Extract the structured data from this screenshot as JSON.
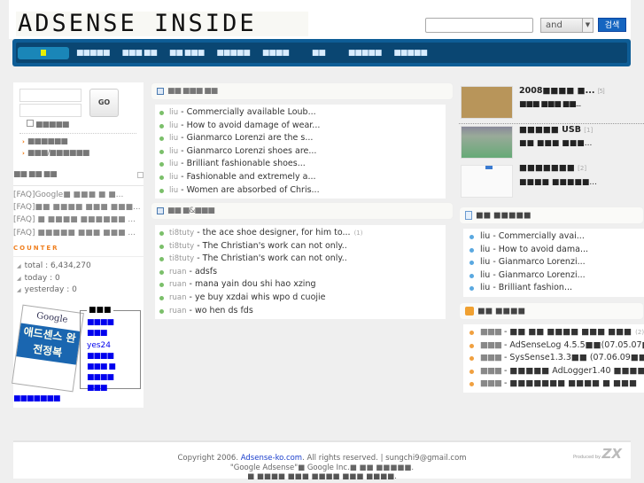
{
  "header": {
    "logo": "ADSENSE INSIDE",
    "search_placeholder": "",
    "search_mode": "and",
    "search_button": "검색"
  },
  "nav": {
    "items": [
      "■■■■■",
      "■■■ ■■",
      "■■ ■■■",
      "■■■■■",
      "■■■■",
      "■■",
      "■■■■■",
      "■■■■■"
    ]
  },
  "login": {
    "go": "GO",
    "remember": "■■■■■",
    "links": [
      "■■■■■■",
      "■■■/■■■■■■"
    ]
  },
  "recent_section": {
    "title": "■■ ■■ ■■",
    "items": [
      "[FAQ]Google■ ■■■ ■ ■...",
      "[FAQ]■■ ■■■■ ■■■ ■■■...",
      "[FAQ] ■ ■■■■ ■■■■■■ ...",
      "[FAQ] ■■■■■ ■■■ ■■■ ..."
    ]
  },
  "counter": {
    "title": "COUNTER",
    "total": "total : 6,434,270",
    "today": "today : 0",
    "yesterday": "yesterday : 0"
  },
  "book": {
    "brand": "Google",
    "title": "애드센스 완전정복",
    "box_title": "■■■",
    "box_lines": [
      "■■■■",
      "■■■",
      "yes24",
      "■■■■",
      "■■■ ■",
      "■■■■",
      "■■■"
    ],
    "bottom_link": "■■■■■■■"
  },
  "recent_posts": {
    "title": "■■ ■■■ ■■",
    "items": [
      {
        "author": "liu",
        "text": "Commercially available Loub..."
      },
      {
        "author": "liu",
        "text": "How to avoid damage of wear..."
      },
      {
        "author": "liu",
        "text": "Gianmarco Lorenzi are the s..."
      },
      {
        "author": "liu",
        "text": "Gianmarco Lorenzi shoes are..."
      },
      {
        "author": "liu",
        "text": "Brilliant fashionable shoes..."
      },
      {
        "author": "liu",
        "text": "Fashionable and extremely a..."
      },
      {
        "author": "liu",
        "text": "Women are absorbed of Chris..."
      }
    ]
  },
  "recent_comments": {
    "title": "■■ ■&■■■",
    "items": [
      {
        "author": "ti8tuty",
        "text": "the ace shoe designer, for him to...",
        "count": "(1)"
      },
      {
        "author": "ti8tuty",
        "text": "The Christian's work can not only.."
      },
      {
        "author": "ti8tuty",
        "text": "The Christian's work can not only.."
      },
      {
        "author": "ruan",
        "text": "adsfs"
      },
      {
        "author": "ruan",
        "text": "mana yain dou shi hao xzing"
      },
      {
        "author": "ruan",
        "text": "ye buy xzdai whis wpo d cuojie"
      },
      {
        "author": "ruan",
        "text": "wo hen ds fds"
      }
    ]
  },
  "gallery": [
    {
      "title": "2008■■■■ ■...",
      "count": "[5]",
      "sub": "■■■ ■■■ ■■..."
    },
    {
      "title": "■■■■■ USB",
      "count": "[1]",
      "sub": "■■ ■■■ ■■■..."
    },
    {
      "title": "■■■■■■■",
      "count": "[2]",
      "sub": "■■■■ ■■■■■..."
    }
  ],
  "right_posts": {
    "title": "■■ ■■■■■",
    "items": [
      {
        "author": "liu",
        "text": "Commercially avai..."
      },
      {
        "author": "liu",
        "text": "How to avoid dama..."
      },
      {
        "author": "liu",
        "text": "Gianmarco Lorenzi..."
      },
      {
        "author": "liu",
        "text": "Gianmarco Lorenzi..."
      },
      {
        "author": "liu",
        "text": "Brilliant fashion..."
      }
    ]
  },
  "downloads": {
    "title": "■■ ■■■■",
    "items": [
      {
        "cat": "■■■",
        "text": "■■ ■■ ■■■■ ■■■ ■■■",
        "count": "(2)"
      },
      {
        "cat": "■■■",
        "text": "AdSenseLog 4.5.5■■(07.05.07■"
      },
      {
        "cat": "■■■",
        "text": "SysSense1.3.3■■ (07.06.09■■)"
      },
      {
        "cat": "■■■",
        "text": "■■■■■ AdLogger1.40 ■■■■"
      },
      {
        "cat": "■■■",
        "text": "■■■■■■■ ■■■■ ■ ■■■"
      }
    ]
  },
  "footer": {
    "line1_pre": "Copyright 2006. ",
    "site": "Adsense-ko.com",
    "line1_post": ". All rights reserved. | sungchi9@gmail.com",
    "line2": "\"Google Adsense\"■  Google Inc.■ ■■ ■■■■■.",
    "line3": "■ ■■■■ ■■■ ■■■■ ■■■ ■■■■.",
    "produced": "Produced by",
    "produced_logo": "ZX"
  },
  "colors": {
    "nav_bg": "#0a4672",
    "accent": "#1565c0",
    "counter": "#f08020",
    "link": "#0000ee"
  }
}
